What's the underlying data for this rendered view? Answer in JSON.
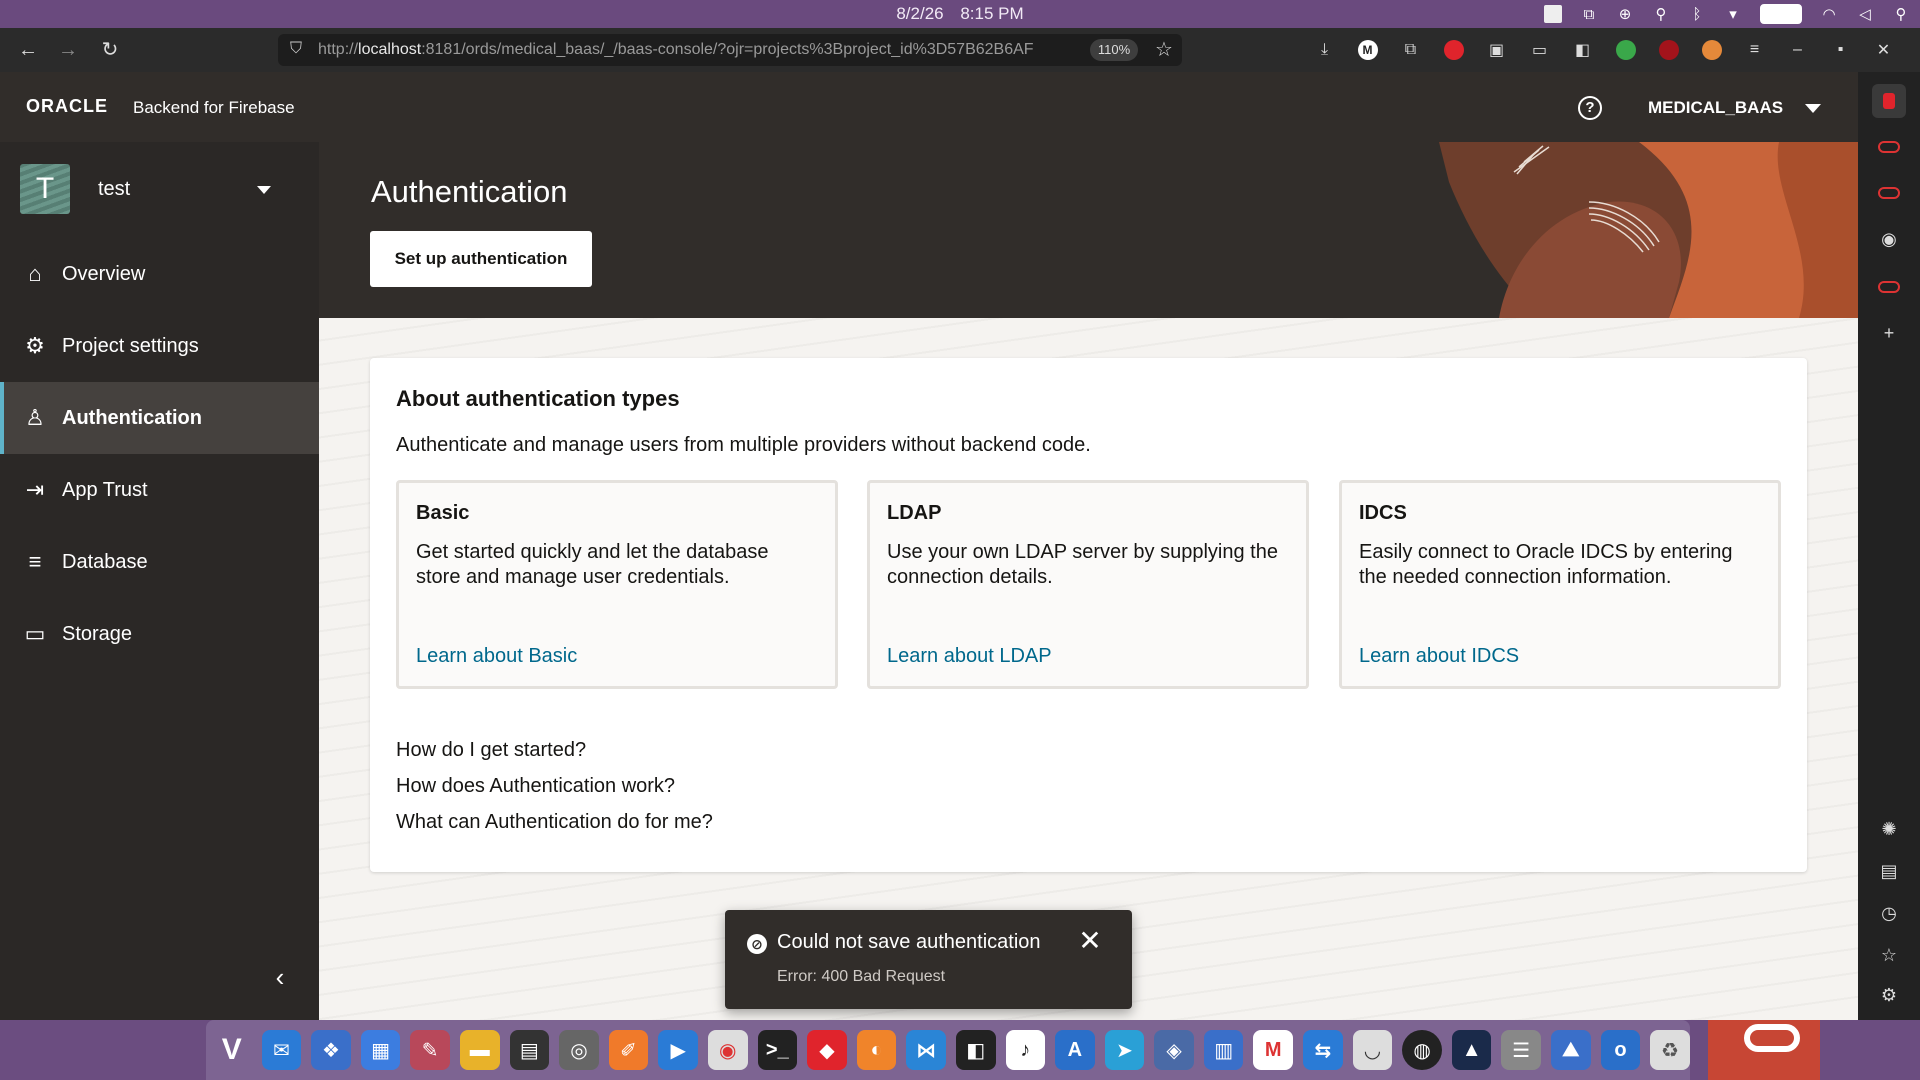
{
  "os": {
    "date": "8/2/26",
    "time": "8:15 PM"
  },
  "browser": {
    "url_prefix": "http://",
    "url_host": "localhost",
    "url_rest": ":8181/ords/medical_baas/_/baas-console/?ojr=projects%3Bproject_id%3D57B62B6AF",
    "zoom": "110%"
  },
  "header": {
    "oracle_logo": "ORACLE",
    "product_name": "Backend for Firebase",
    "help_glyph": "?",
    "user": "MEDICAL_BAAS"
  },
  "project": {
    "avatar_letter": "T",
    "name": "test"
  },
  "sidebar": {
    "items": [
      {
        "label": "Overview",
        "icon": "home-icon",
        "glyph": "⌂"
      },
      {
        "label": "Project settings",
        "icon": "gears-icon",
        "glyph": "⚙"
      },
      {
        "label": "Authentication",
        "icon": "user-icon",
        "glyph": "♙"
      },
      {
        "label": "App Trust",
        "icon": "sign-in-icon",
        "glyph": "⇥"
      },
      {
        "label": "Database",
        "icon": "database-icon",
        "glyph": "≡"
      },
      {
        "label": "Storage",
        "icon": "archive-icon",
        "glyph": "▭"
      }
    ],
    "active_index": 2,
    "collapse_glyph": "‹"
  },
  "hero": {
    "title": "Authentication",
    "setup_button": "Set up authentication"
  },
  "about": {
    "title": "About authentication types",
    "description": "Authenticate and manage users from multiple providers without backend code.",
    "types": [
      {
        "name": "Basic",
        "description": "Get started quickly and let the database store and manage user credentials.",
        "link": "Learn about Basic"
      },
      {
        "name": "LDAP",
        "description": "Use your own LDAP server by supplying the connection details.",
        "link": "Learn about LDAP"
      },
      {
        "name": "IDCS",
        "description": "Easily connect to Oracle IDCS by entering the needed connection information.",
        "link": "Learn about IDCS"
      }
    ],
    "faqs": [
      "How do I get started?",
      "How does Authentication work?",
      "What can Authentication do for me?"
    ]
  },
  "toast": {
    "title": "Could not save authentication",
    "detail": "Error: 400 Bad Request",
    "close_glyph": "✕"
  },
  "colors": {
    "header_bg": "#312d2a",
    "link": "#00688c",
    "active_accent": "#5fb3c9",
    "oracle_red": "#c74634"
  }
}
